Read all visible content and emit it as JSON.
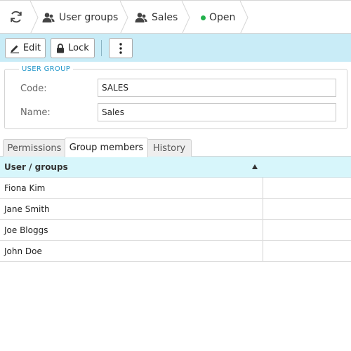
{
  "breadcrumb": {
    "items": [
      {
        "label": "User groups",
        "icon": "users-icon"
      },
      {
        "label": "Sales",
        "icon": "users-icon"
      },
      {
        "label": "Open",
        "icon": "status-dot-icon",
        "status_color": "#22b14c"
      }
    ]
  },
  "toolbar": {
    "edit_label": "Edit",
    "lock_label": "Lock"
  },
  "user_group": {
    "legend": "USER GROUP",
    "code_label": "Code:",
    "code_value": "SALES",
    "name_label": "Name:",
    "name_value": "Sales"
  },
  "tabs": [
    {
      "label": "Permissions",
      "active": false
    },
    {
      "label": "Group members",
      "active": true
    },
    {
      "label": "History",
      "active": false
    }
  ],
  "grid": {
    "column_header": "User / groups",
    "sort": "ascending",
    "rows": [
      "Fiona Kim",
      "Jane Smith",
      "Joe Bloggs",
      "John Doe"
    ]
  },
  "colors": {
    "toolbar_bg": "#c9ecf7",
    "grid_header_bg": "#d7f6fb",
    "legend": "#2196c9",
    "status_open": "#22b14c"
  }
}
